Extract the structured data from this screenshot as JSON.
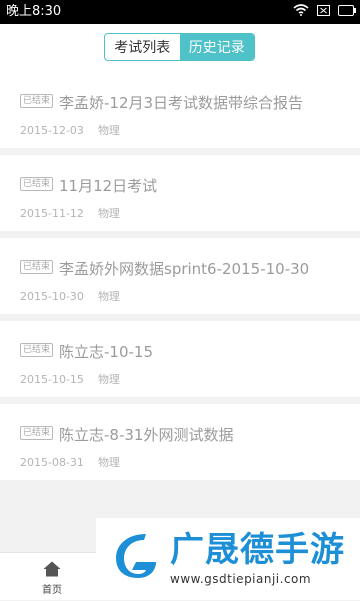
{
  "status_bar": {
    "time": "晚上8:30",
    "icons": [
      "wifi-icon",
      "sim-none-icon",
      "battery-icon"
    ]
  },
  "header": {
    "tabs": [
      {
        "label": "考试列表",
        "active": false
      },
      {
        "label": "历史记录",
        "active": true
      }
    ],
    "accent_color": "#4fc1c9"
  },
  "records": [
    {
      "badge": "已结束",
      "title": "李孟娇-12月3日考试数据带综合报告",
      "date": "2015-12-03",
      "subject": "物理"
    },
    {
      "badge": "已结束",
      "title": "11月12日考试",
      "date": "2015-11-12",
      "subject": "物理"
    },
    {
      "badge": "已结束",
      "title": "李孟娇外网数据sprint6-2015-10-30",
      "date": "2015-10-30",
      "subject": "物理"
    },
    {
      "badge": "已结束",
      "title": "陈立志-10-15",
      "date": "2015-10-15",
      "subject": "物理"
    },
    {
      "badge": "已结束",
      "title": "陈立志-8-31外网测试数据",
      "date": "2015-08-31",
      "subject": "物理"
    }
  ],
  "tabbar": {
    "items": [
      {
        "label": "首页",
        "icon": "home-icon"
      }
    ]
  },
  "watermark": {
    "title": "广晟德手游",
    "url": "www.gsdtiepianji.com",
    "brand_color": "#1d8fd7"
  }
}
